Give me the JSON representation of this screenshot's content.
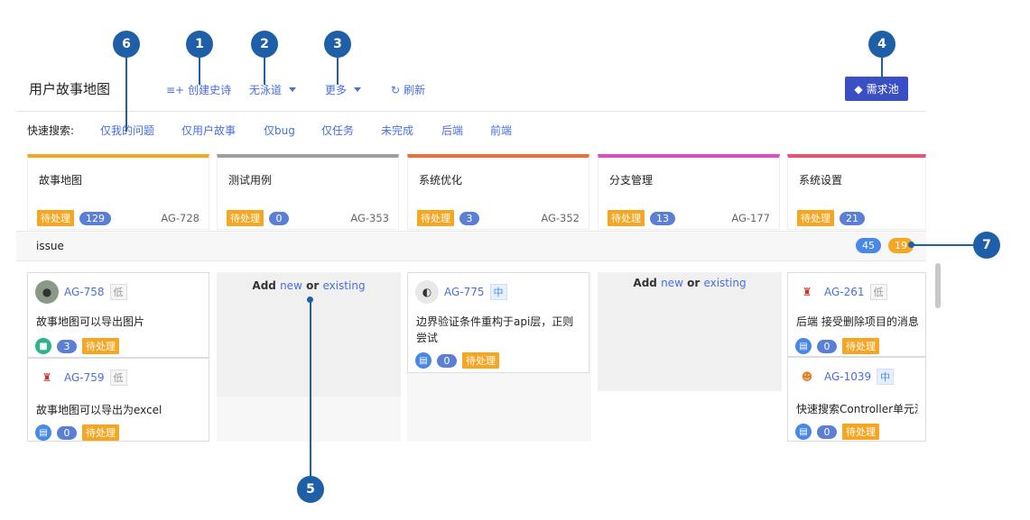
{
  "header": {
    "title": "用户故事地图",
    "create_story": "创建史诗",
    "swimlane_select": "无泳道",
    "more": "更多",
    "refresh": "刷新",
    "backlog": "需求池"
  },
  "quick_search": {
    "label": "快速搜索:",
    "items": [
      "仅我的问题",
      "仅用户故事",
      "仅bug",
      "仅任务",
      "未完成",
      "后端",
      "前端"
    ]
  },
  "epics": [
    {
      "title": "故事地图",
      "status": "待处理",
      "count": "129",
      "key": "AG-728",
      "color": "#f5a623"
    },
    {
      "title": "测试用例",
      "status": "待处理",
      "count": "0",
      "key": "AG-353",
      "color": "#9e9e9e"
    },
    {
      "title": "系统优化",
      "status": "待处理",
      "count": "3",
      "key": "AG-352",
      "color": "#f26b3a"
    },
    {
      "title": "分支管理",
      "status": "待处理",
      "count": "13",
      "key": "AG-177",
      "color": "#e04bc8"
    },
    {
      "title": "系统设置",
      "status": "待处理",
      "count": "21",
      "key": "",
      "color": "#f0506e"
    }
  ],
  "swimlane": {
    "title": "issue",
    "count_blue": "45",
    "count_orange": "19"
  },
  "add_placeholder": {
    "prefix": "Add",
    "new": "new",
    "or": "or",
    "existing": "existing"
  },
  "cards": [
    {
      "key": "AG-758",
      "prio": "低",
      "summary": "故事地图可以导出图片",
      "count": "3",
      "status": "待处理"
    },
    {
      "key": "AG-759",
      "prio": "低",
      "summary": "故事地图可以导出为excel",
      "count": "0",
      "status": "待处理"
    },
    {
      "key": "AG-775",
      "prio": "中",
      "summary": "边界验证条件重构于api层，正则尝试",
      "count": "0",
      "status": "待处理"
    },
    {
      "key": "AG-261",
      "prio": "低",
      "summary": "后端 接受删除项目的消息",
      "count": "0",
      "status": "待处理"
    },
    {
      "key": "AG-1039",
      "prio": "中",
      "summary": "快速搜索Controller单元测",
      "count": "0",
      "status": "待处理"
    }
  ],
  "markers": [
    "1",
    "2",
    "3",
    "4",
    "5",
    "6",
    "7"
  ]
}
